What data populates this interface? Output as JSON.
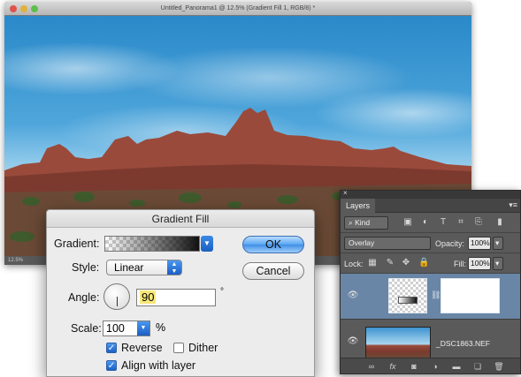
{
  "document": {
    "title": "Untitled_Panorama1 @ 12.5% (Gradient Fill 1, RGB/8) *",
    "status": "12.5%"
  },
  "dialog": {
    "title": "Gradient Fill",
    "gradient_label": "Gradient:",
    "style_label": "Style:",
    "style_value": "Linear",
    "angle_label": "Angle:",
    "angle_value": "90",
    "angle_unit": "°",
    "scale_label": "Scale:",
    "scale_value": "100",
    "scale_unit": "%",
    "reverse_label": "Reverse",
    "reverse_checked": true,
    "dither_label": "Dither",
    "dither_checked": false,
    "align_label": "Align with layer",
    "align_checked": true,
    "ok_label": "OK",
    "cancel_label": "Cancel"
  },
  "layers_panel": {
    "tab_label": "Layers",
    "filter_kind": "Kind",
    "blend_mode": "Overlay",
    "opacity_label": "Opacity:",
    "opacity_value": "100%",
    "lock_label": "Lock:",
    "fill_label": "Fill:",
    "fill_value": "100%",
    "layers": [
      {
        "name": "",
        "type": "gradient-fill-adjustment",
        "selected": true
      },
      {
        "name": "_DSC1863.NEF",
        "type": "image",
        "selected": false
      }
    ],
    "bottom_icons": [
      "link-icon",
      "fx-icon",
      "mask-icon",
      "adjustment-icon",
      "folder-icon",
      "new-layer-icon",
      "trash-icon"
    ],
    "fx_label": "fx"
  }
}
